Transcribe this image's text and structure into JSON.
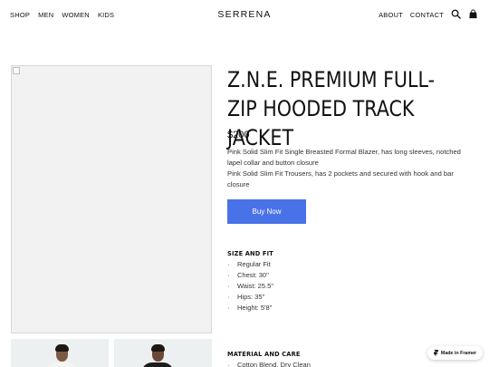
{
  "nav": {
    "left_links": [
      "SHOP",
      "MEN",
      "WOMEN",
      "KIDS"
    ],
    "brand": "SERRENA",
    "right_links": [
      "ABOUT",
      "CONTACT"
    ],
    "icons": [
      "search-icon",
      "shopping-bag-icon"
    ]
  },
  "product": {
    "title": "Z.N.E. PREMIUM FULL-ZIP HOODED TRACK JACKET",
    "price": "$200",
    "description": [
      "Pink Solid Slim Fit Single Breasted Formal Blazer, has long sleeves, notched lapel collar and button closure",
      "Pink Solid Slim Fit Trousers, has 2 pockets and secured with hook and bar closure"
    ],
    "buy_label": "Buy Now"
  },
  "size_fit": {
    "heading": "SIZE AND FIT",
    "items": [
      "Regular Fit",
      "Chest: 30''",
      "Waist: 25.5''",
      "Hips: 35''",
      "Height: 5'8''"
    ]
  },
  "material_care": {
    "heading": "MATERIAL AND CARE",
    "items": [
      "Cotton Blend, Dry Clean"
    ]
  },
  "badge": {
    "label": "Made in Framer"
  },
  "colors": {
    "accent": "#4a72e8",
    "text": "#111111",
    "image_bg": "#f2f2f2",
    "thumb_bg": "#edf0f1"
  }
}
